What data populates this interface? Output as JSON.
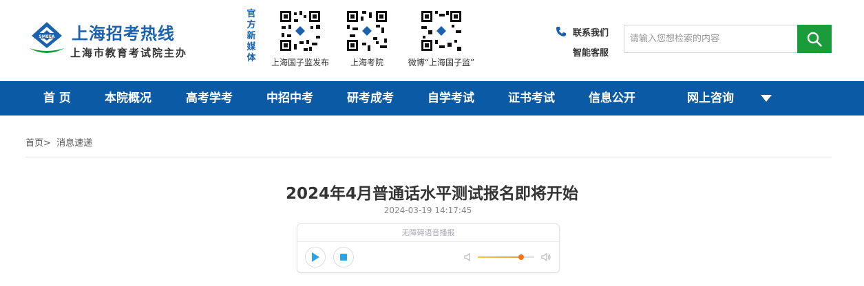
{
  "header": {
    "site_title": "上海招考热线",
    "site_subtitle": "上海市教育考试院主办",
    "logo_icon": "smeea-logo-icon",
    "media_label": "官方新媒体",
    "qr_codes": [
      {
        "caption": "上海国子监发布"
      },
      {
        "caption": "上海考院"
      },
      {
        "caption": "微博“上海国子监”"
      }
    ],
    "contact_label": "联系我们",
    "service_label": "智能客服",
    "search_placeholder": "请输入您想检索的内容"
  },
  "nav": {
    "items": [
      "首 页",
      "本院概况",
      "高考学考",
      "中招中考",
      "研考成考",
      "自学考试",
      "证书考试",
      "信息公开",
      "网上咨询"
    ]
  },
  "breadcrumb": {
    "home": "首页",
    "separator": ">",
    "current": "消息速递"
  },
  "article": {
    "title": "2024年4月普通话水平测试报名即将开始",
    "time": "2024-03-19 14:17:45"
  },
  "player": {
    "label": "无障碍语音播报",
    "volume_fraction": 0.77
  },
  "colors": {
    "brand_blue": "#1a62b0",
    "nav_blue": "#0b5aa5",
    "search_green": "#1a9c3a",
    "volume_orange": "#f5741a"
  }
}
